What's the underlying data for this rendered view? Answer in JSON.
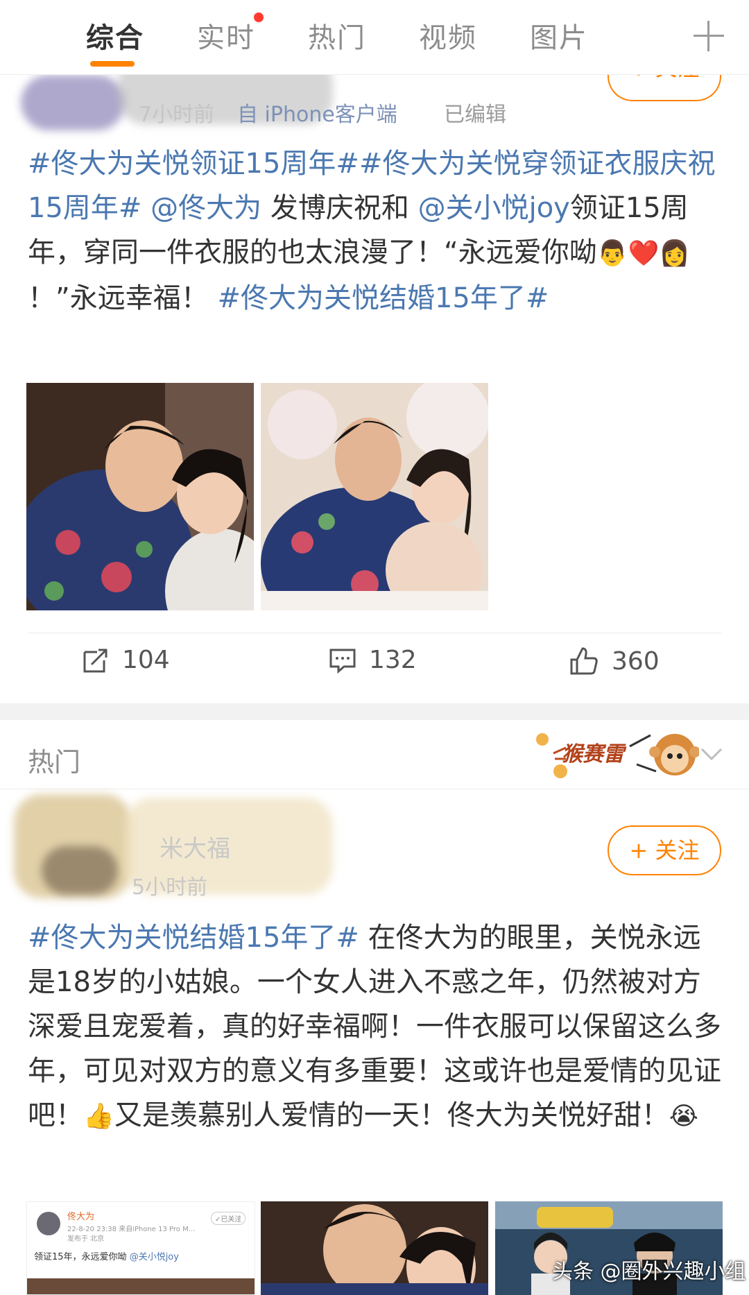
{
  "tabs": [
    {
      "label": "综合",
      "active": true
    },
    {
      "label": "实时",
      "active": false,
      "has_dot": true
    },
    {
      "label": "热门",
      "active": false
    },
    {
      "label": "视频",
      "active": false
    },
    {
      "label": "图片",
      "active": false
    }
  ],
  "accent_color": "#ff8200",
  "link_color": "#4b78b0",
  "post1": {
    "time": "7小时前",
    "source": "自 iPhone客户端",
    "edited": "已编辑",
    "follow_label": "+ 关注",
    "text": {
      "topic1": "#佟大为关悦领证15周年#",
      "topic2": "#佟大为关悦穿领证衣服庆祝15周年#",
      "mention1": "@佟大为",
      "t1": " 发博庆祝和 ",
      "mention2": "@关小悦joy",
      "t2": "领证15周年，穿同一件衣服的也太浪漫了！“永远爱你呦",
      "emoji1": "👨‍❤️‍👩",
      "t3": "！”永远幸福！ ",
      "topic3": "#佟大为关悦结婚15年了#"
    },
    "stats": {
      "repost": "104",
      "comment": "132",
      "like": "360"
    }
  },
  "section": {
    "title": "热门",
    "banner_text": "猴赛雷"
  },
  "post2": {
    "name": "米大福",
    "time": "5小时前",
    "follow_label": "+ 关注",
    "text": {
      "topic1": "#佟大为关悦结婚15年了#",
      "t1": " 在佟大为的眼里，关悦永远是18岁的小姑娘。一个女人进入不惑之年，仍然被对方深爱且宠爱着，真的好幸福啊！一件衣服可以保留这么多年，可见对双方的意义有多重要！这或许也是爱情的见证吧！",
      "emoji1": "👍",
      "t2": "又是羡慕别人爱情的一天！佟大为关悦好甜！",
      "emoji2": "😭"
    },
    "thumb1": {
      "name": "佟大为",
      "meta": "22-8-20 23:38 来自iPhone 13 Pro M...",
      "loc": "发布于 北京",
      "followed": "✓已关注",
      "text": "领证15年，永远爱你呦",
      "mention": "@关小悦joy"
    }
  },
  "watermark": "头条 @圈外兴趣小组"
}
